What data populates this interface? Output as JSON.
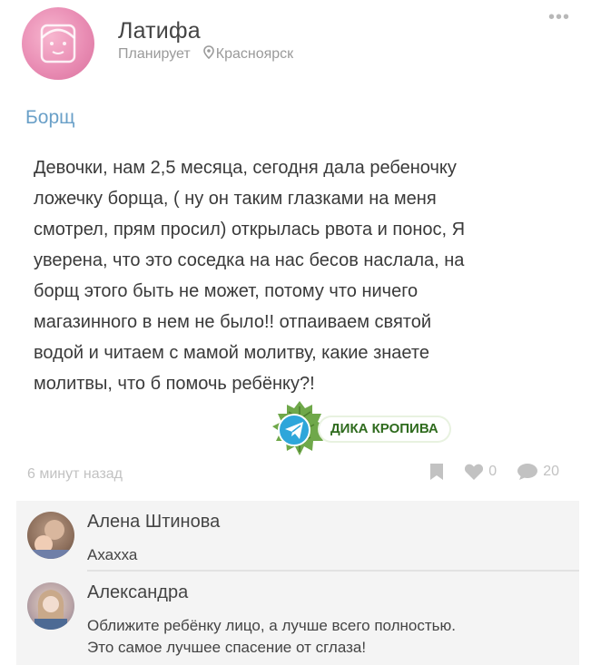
{
  "post": {
    "author": {
      "name": "Латифа",
      "status": "Планирует",
      "location": "Красноярск",
      "avatar_icon": "pink-face-avatar"
    },
    "more_icon": "more-dots-icon",
    "title": "Борщ",
    "body": "Девочки, нам 2,5 месяца, сегодня дала ребеночку\nложечку борща, ( ну он таким глазками на меня\nсмотрел, прям просил) открылась рвота и понос, Я\nуверена, что это соседка на нас бесов наслала, на\nборщ этого быть не может, потому что ничего\nмагазинного в нем не было!! отпаиваем святой\nводой и читаем с мамой молитву, какие знаете\nмолитвы, что б помочь ребёнку?!",
    "time": "6 минут назад",
    "likes": "0",
    "comments_count": "20"
  },
  "watermark": {
    "label": "ДИКА КРОПИВА",
    "icon": "telegram-icon"
  },
  "comments": [
    {
      "name": "Алена Штинова",
      "text": "Ахахха"
    },
    {
      "name": "Александра",
      "text": "Оближите ребёнку лицо, а лучше всего полностью.\nЭто самое лучшее спасение от сглаза!"
    }
  ],
  "colors": {
    "title": "#6aa0c8",
    "muted": "#c2c2c2",
    "watermark_green": "#2f6b1e",
    "comment_bg": "#f4f4f4"
  }
}
